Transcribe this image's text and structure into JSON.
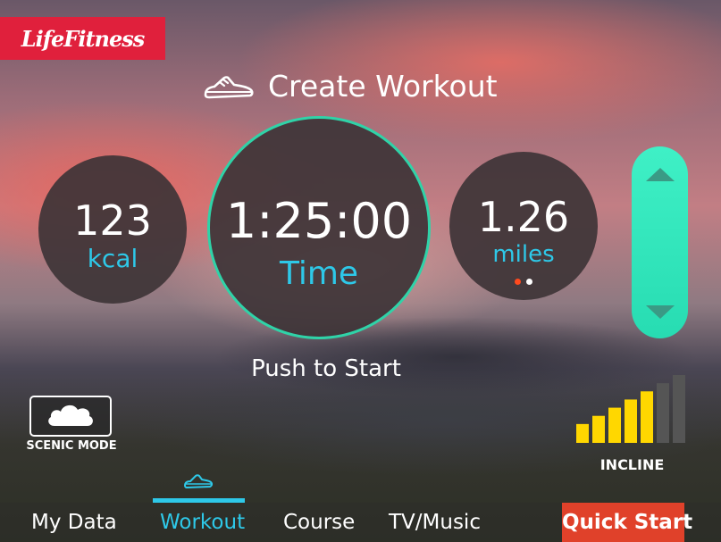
{
  "brand": {
    "logo_text": "LifeFitness",
    "logo_color": "#e0203c"
  },
  "header": {
    "title": "Create Workout",
    "icon": "shoe-icon"
  },
  "metrics": {
    "calories": {
      "value": "123",
      "unit": "kcal"
    },
    "time": {
      "value": "1:25:00",
      "unit": "Time"
    },
    "distance": {
      "value": "1.26",
      "unit": "miles",
      "pages": 2,
      "active_page": 1
    }
  },
  "actions": {
    "push_to_start": "Push to Start"
  },
  "scenic": {
    "label": "SCENIC MODE",
    "icon": "cloud-icon"
  },
  "incline": {
    "label": "INCLINE",
    "level": 5,
    "max": 7,
    "active_color": "#ffd700",
    "inactive_color": "#555555"
  },
  "nav": {
    "tabs": [
      {
        "label": "My Data"
      },
      {
        "label": "Workout",
        "active": true
      },
      {
        "label": "Course"
      },
      {
        "label": "TV/Music"
      }
    ],
    "quick_start": "Quick Start",
    "active_color": "#2ec8e8",
    "quick_start_color": "#e0412a"
  },
  "colors": {
    "accent": "#2ec8e8",
    "slider": "#2fd3a8"
  }
}
